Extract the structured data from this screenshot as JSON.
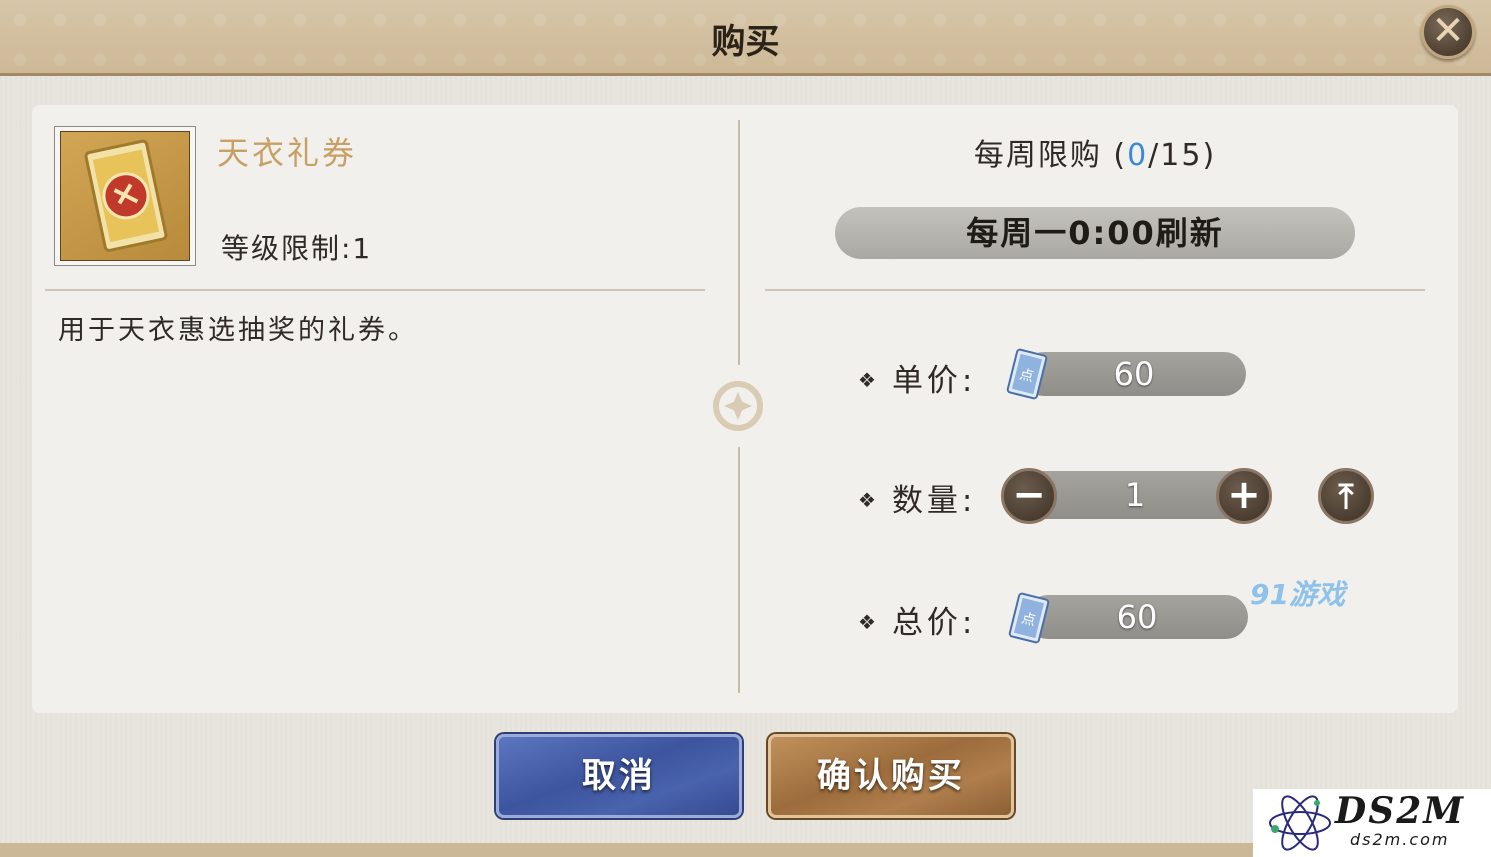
{
  "dialog": {
    "title": "购买"
  },
  "item": {
    "name": "天衣礼券",
    "level_limit": "等级限制:1",
    "description": "用于天衣惠选抽奖的礼券。"
  },
  "purchase_limit": {
    "label": "每周限购 (",
    "current": "0",
    "rest": "/15)",
    "refresh_text": "每周一0:00刷新"
  },
  "price": {
    "unit_label": "单价:",
    "unit_value": "60",
    "quantity_label": "数量:",
    "quantity_value": "1",
    "total_label": "总价:",
    "total_value": "60",
    "currency_icon": "scroll-ticket-icon"
  },
  "buttons": {
    "cancel": "取消",
    "confirm": "确认购买"
  },
  "watermarks": {
    "game91": "91游戏",
    "logo": "DS2M",
    "logo_sub": "ds2m.com"
  },
  "colors": {
    "accent_blue": "#3a8ad8",
    "item_name": "#c8a064",
    "cancel_btn": "#3d549e",
    "confirm_btn": "#9c6c3c"
  }
}
